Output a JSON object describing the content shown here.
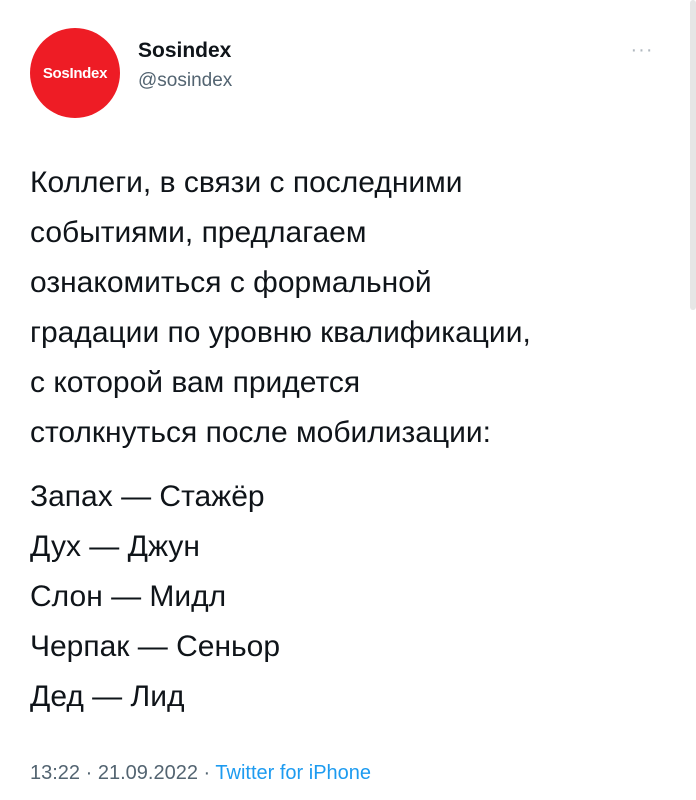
{
  "account": {
    "avatar_text": "SosIndex",
    "avatar_color": "#ee1c25",
    "display_name": "Sosindex",
    "handle": "@sosindex",
    "menu_icon": "more-horizontal-icon"
  },
  "tweet": {
    "lines": [
      "Коллеги, в связи с последними",
      "событиями, предлагаем",
      "ознакомиться с формальной",
      "градации по уровню квалификации,",
      "с которой вам придется",
      "столкнуться после мобилизации:"
    ],
    "grades": [
      "Запах — Стажёр",
      "Дух — Джун",
      "Слон — Мидл",
      "Черпак — Сеньор",
      "Дед — Лид"
    ]
  },
  "meta": {
    "time": "13:22",
    "separator": "·",
    "date": "21.09.2022",
    "source": "Twitter for iPhone",
    "source_color": "#1d9bf0"
  }
}
